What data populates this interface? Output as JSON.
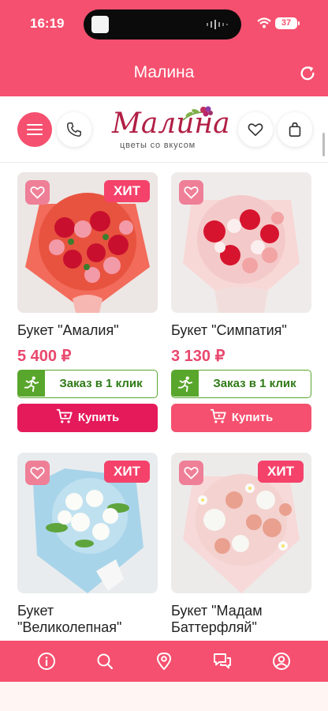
{
  "status_bar": {
    "time": "16:19",
    "battery": "37"
  },
  "app": {
    "title": "Малина"
  },
  "header": {
    "logo_name": "Малина",
    "logo_tagline": "цветы со вкусом"
  },
  "products": [
    {
      "name": "Букет \"Амалия\"",
      "price": "5 400 ₽",
      "badge": "ХИТ",
      "one_click_label": "Заказ в 1 клик",
      "buy_label": "Купить"
    },
    {
      "name": "Букет \"Симпатия\"",
      "price": "3 130 ₽",
      "badge": "",
      "one_click_label": "Заказ в 1 клик",
      "buy_label": "Купить"
    },
    {
      "name": "Букет \"Великолепная\"",
      "badge": "ХИТ"
    },
    {
      "name": "Букет \"Мадам Баттерфляй\"",
      "badge": "ХИТ"
    }
  ],
  "bottom_nav": [
    {
      "icon": "info-icon"
    },
    {
      "icon": "search-icon"
    },
    {
      "icon": "location-pin-icon"
    },
    {
      "icon": "chat-icon"
    },
    {
      "icon": "profile-icon"
    }
  ],
  "colors": {
    "brand": "#f5506f",
    "buy": "#e41a5a",
    "green": "#59a62c",
    "price": "#e9476d"
  }
}
